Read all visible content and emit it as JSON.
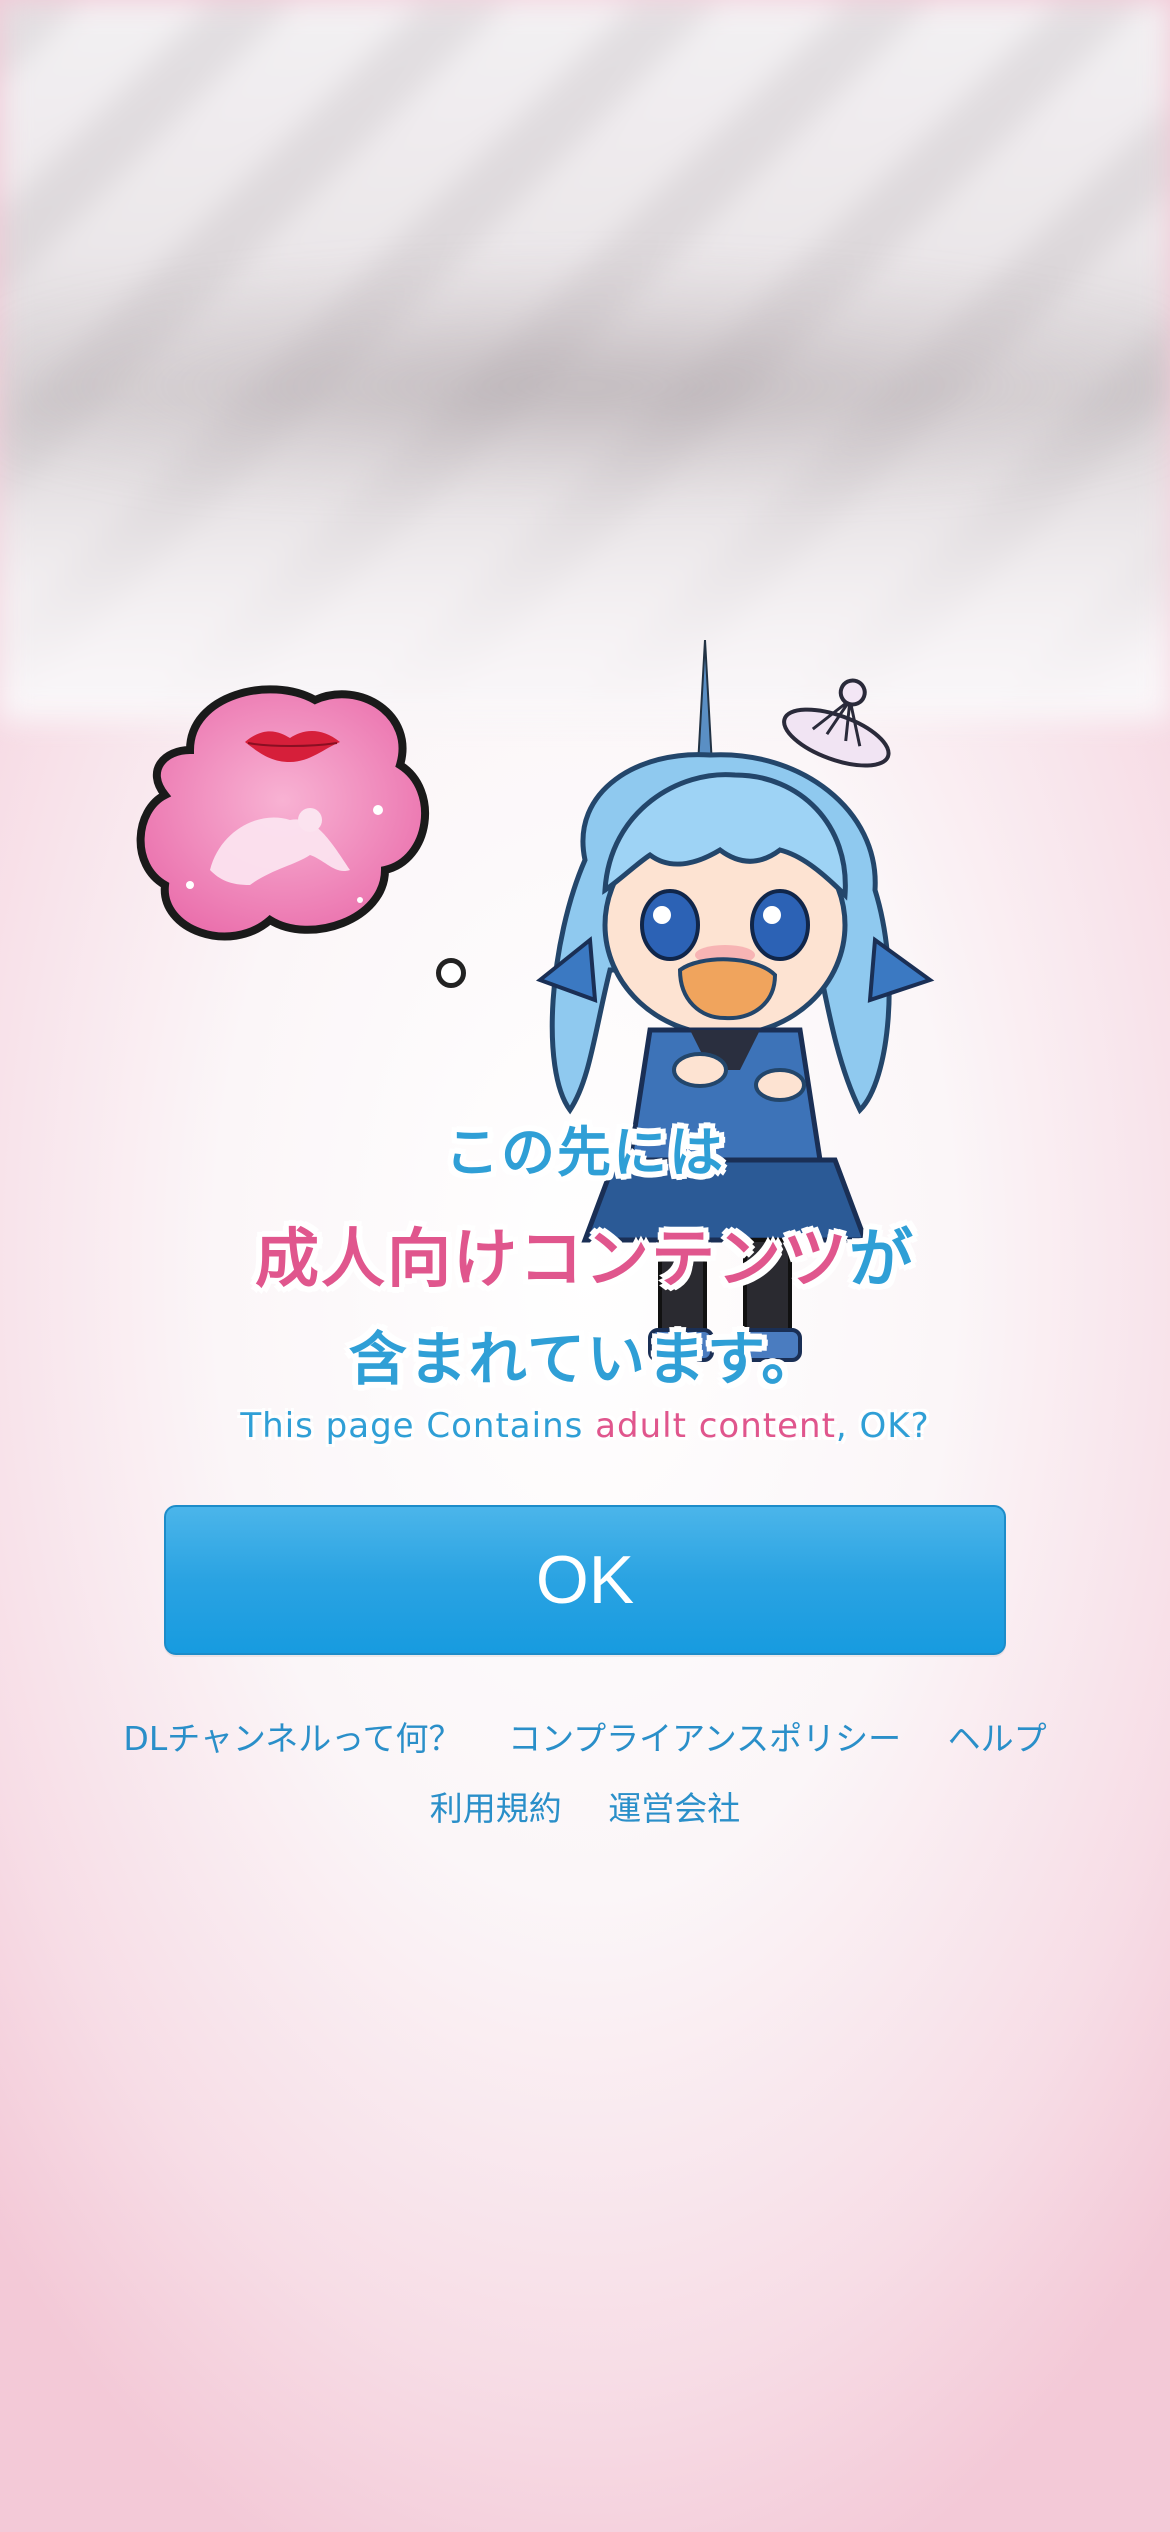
{
  "heading": {
    "line1": "この先には",
    "line2_highlight": "成人向けコンテンツ",
    "line2_rest": "が",
    "line3": "含まれています。"
  },
  "subtitle": {
    "part1": "This page Contains ",
    "highlight": "adult content",
    "part2": ", OK?"
  },
  "ok_button": {
    "label": "OK"
  },
  "footer_links": {
    "row1": [
      "DLチャンネルって何？",
      "コンプライアンスポリシー",
      "ヘルプ"
    ],
    "row2": [
      "利用規約",
      "運営会社"
    ]
  },
  "colors": {
    "accent_blue": "#2f9fd6",
    "accent_pink": "#e0568d",
    "button_blue": "#2aa3e2"
  },
  "illustration": {
    "character_icon": "mascot-girl-icon",
    "thought_icon": "thought-bubble-icon",
    "lips_icon": "lips-icon"
  }
}
